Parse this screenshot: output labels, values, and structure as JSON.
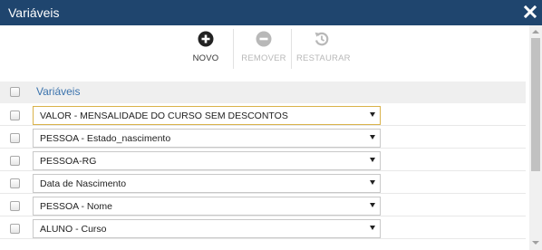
{
  "window": {
    "title": "Variáveis"
  },
  "toolbar": {
    "novo_label": "NOVO",
    "remover_label": "REMOVER",
    "restaurar_label": "RESTAURAR"
  },
  "table": {
    "header_label": "Variáveis",
    "rows": [
      {
        "value": "VALOR - MENSALIDADE DO CURSO SEM DESCONTOS"
      },
      {
        "value": "PESSOA - Estado_nascimento"
      },
      {
        "value": "PESSOA-RG"
      },
      {
        "value": "Data de Nascimento"
      },
      {
        "value": "PESSOA - Nome"
      },
      {
        "value": "ALUNO - Curso"
      }
    ]
  },
  "colors": {
    "titlebar": "#1f456e",
    "header_text": "#3b73ad",
    "focus_border": "#d9b24a"
  }
}
